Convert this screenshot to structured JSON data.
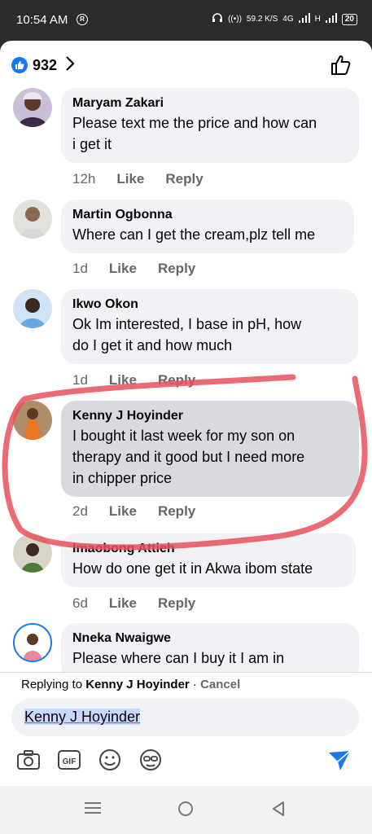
{
  "status": {
    "time": "10:54 AM",
    "badge": "R",
    "speed": "59.2",
    "speed_unit": "K/S",
    "net": "4G",
    "signal2": "H",
    "battery": "20"
  },
  "reactions": {
    "count": "932"
  },
  "comments": [
    {
      "name": "Maryam Zakari",
      "line1": "Please text me the price and how can",
      "line2": "i get it",
      "line3": "",
      "time": "12h",
      "like": "Like",
      "reply": "Reply"
    },
    {
      "name": "Martin Ogbonna",
      "line1": "Where can I get the cream,plz tell me",
      "line2": "",
      "line3": "",
      "time": "1d",
      "like": "Like",
      "reply": "Reply"
    },
    {
      "name": "Ikwo Okon",
      "line1": "Ok Im interested, I base in pH, how",
      "line2": "do I get it and how much",
      "line3": "",
      "time": "1d",
      "like": "Like",
      "reply": "Reply"
    },
    {
      "name": "Kenny J Hoyinder",
      "line1": "I bought it last week for my son on",
      "line2": "therapy and it good but I need more",
      "line3": "in chipper price",
      "time": "2d",
      "like": "Like",
      "reply": "Reply"
    },
    {
      "name": "Imaobong Attieh",
      "line1": "How do one get it in Akwa ibom state",
      "line2": "",
      "line3": "",
      "time": "6d",
      "like": "Like",
      "reply": "Reply"
    },
    {
      "name": "Nneka Nwaigwe",
      "line1": "Please where can I buy it I am in",
      "line2": "",
      "line3": "",
      "time": "",
      "like": "",
      "reply": ""
    }
  ],
  "reply_bar": {
    "prefix": "Replying to",
    "target": "Kenny J Hoyinder",
    "separator": "·",
    "cancel": "Cancel",
    "input_value": "Kenny J Hoyinder",
    "gif_label": "GIF"
  },
  "colors": {
    "accent": "#1877f2",
    "annotation": "#e8505b"
  },
  "icons": [
    "like-icon",
    "chevron-right-icon",
    "thumbs-up-outline-icon",
    "camera-icon",
    "gif-icon",
    "emoji-icon",
    "avatar-sticker-icon",
    "send-icon",
    "menu-icon",
    "home-icon",
    "back-icon"
  ]
}
